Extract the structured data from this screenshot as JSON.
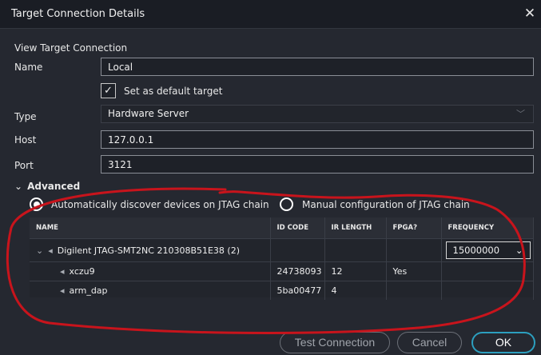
{
  "dialog": {
    "title": "Target Connection Details",
    "close_glyph": "✕"
  },
  "section_title": "View Target Connection",
  "form": {
    "name": {
      "label": "Name",
      "value": "Local"
    },
    "default_target": {
      "label": "Set as default target",
      "checked": true,
      "check_glyph": "✓"
    },
    "type": {
      "label": "Type",
      "value": "Hardware Server",
      "chevron": "﹀"
    },
    "host": {
      "label": "Host",
      "value": "127.0.0.1"
    },
    "port": {
      "label": "Port",
      "value": "3121"
    }
  },
  "advanced": {
    "label": "Advanced",
    "chevron": "⌄",
    "radio_auto": {
      "label": "Automatically discover devices on JTAG chain",
      "selected": true
    },
    "radio_manual": {
      "label": "Manual configuration of JTAG chain",
      "selected": false
    }
  },
  "table": {
    "columns": [
      "NAME",
      "ID CODE",
      "IR LENGTH",
      "FPGA?",
      "FREQUENCY"
    ],
    "rows": [
      {
        "expander": "⌄",
        "icon": "◂",
        "name": "Digilent JTAG-SMT2NC 210308B51E38 (2)",
        "id_code": "",
        "ir_length": "",
        "fpga": "",
        "frequency": "15000000",
        "freq_chevron": "⌄"
      },
      {
        "icon": "◂",
        "name": "xczu9",
        "id_code": "24738093",
        "ir_length": "12",
        "fpga": "Yes",
        "frequency": ""
      },
      {
        "icon": "◂",
        "name": "arm_dap",
        "id_code": "5ba00477",
        "ir_length": "4",
        "fpga": "",
        "frequency": ""
      }
    ]
  },
  "buttons": {
    "test": "Test Connection",
    "cancel": "Cancel",
    "ok": "OK"
  },
  "colors": {
    "background": "#252830",
    "titlebar": "#1a1d24",
    "ok_border": "#2c9fbf",
    "annotation": "#c8141c"
  }
}
